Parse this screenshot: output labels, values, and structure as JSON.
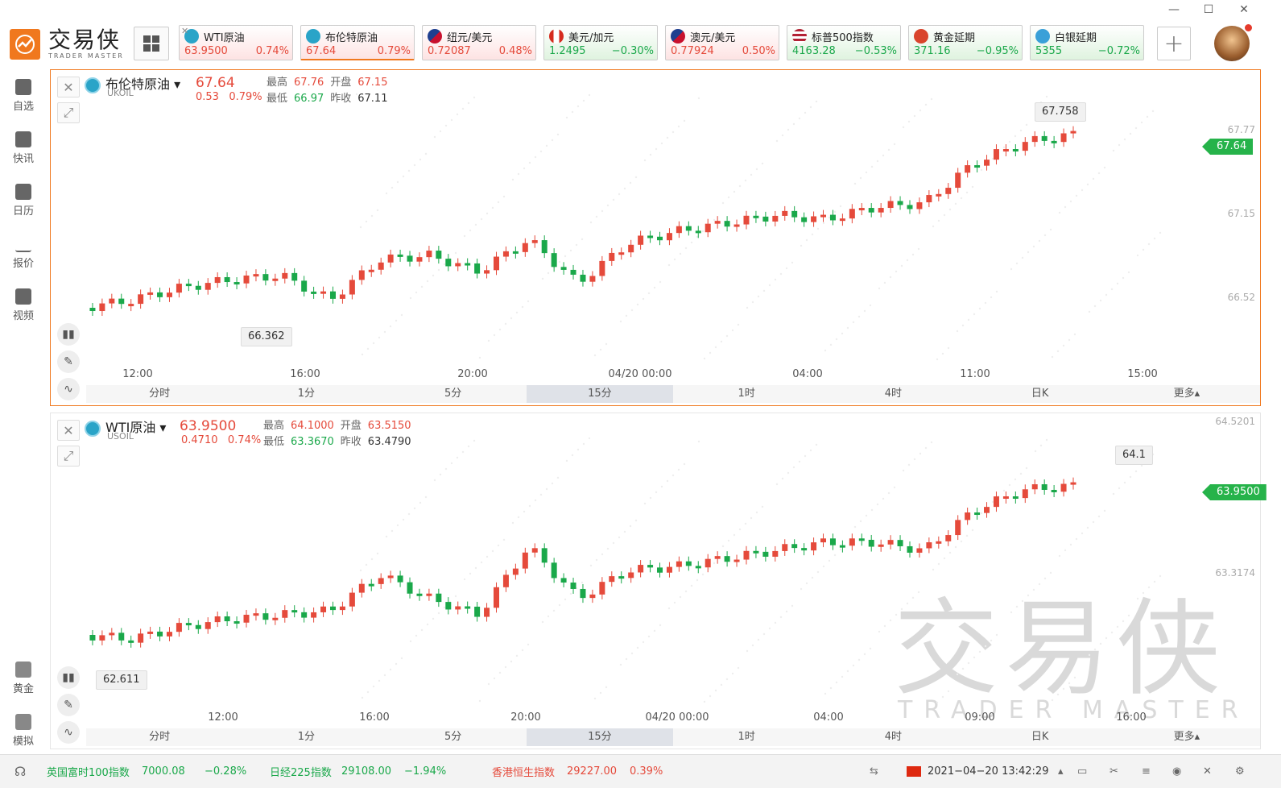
{
  "window": {
    "min": "—",
    "max": "☐",
    "close": "✕"
  },
  "logo": {
    "cn": "交易侠",
    "en": "TRADER MASTER"
  },
  "tickers": [
    {
      "name": "WTI原油",
      "price": "63.9500",
      "change": "0.74%",
      "dir": "up"
    },
    {
      "name": "布伦特原油",
      "price": "67.64",
      "change": "0.79%",
      "dir": "up"
    },
    {
      "name": "纽元/美元",
      "price": "0.72087",
      "change": "0.48%",
      "dir": "up"
    },
    {
      "name": "美元/加元",
      "price": "1.2495",
      "change": "−0.30%",
      "dir": "down"
    },
    {
      "name": "澳元/美元",
      "price": "0.77924",
      "change": "0.50%",
      "dir": "up"
    },
    {
      "name": "标普500指数",
      "price": "4163.28",
      "change": "−0.53%",
      "dir": "down"
    },
    {
      "name": "黄金延期",
      "price": "371.16",
      "change": "−0.95%",
      "dir": "down"
    },
    {
      "name": "白银延期",
      "price": "5355",
      "change": "−0.72%",
      "dir": "down"
    }
  ],
  "sidebar": {
    "items": [
      {
        "label": "自选"
      },
      {
        "label": "快讯"
      },
      {
        "label": "日历"
      },
      {
        "label": "报价"
      },
      {
        "label": "视频"
      },
      {
        "label": "黄金"
      },
      {
        "label": "模拟"
      }
    ]
  },
  "panel1": {
    "name": "布伦特原油",
    "code": "UKOIL",
    "price": "67.64",
    "chg_abs": "0.53",
    "chg_pct": "0.79%",
    "high_label": "最高",
    "high": "67.76",
    "open_label": "开盘",
    "open": "67.15",
    "low_label": "最低",
    "low": "66.97",
    "prev_label": "昨收",
    "prev": "67.11",
    "y_ticks": [
      "67.77",
      "67.15",
      "66.52"
    ],
    "last_tag": "67.64",
    "max_label": "67.758",
    "min_label": "66.362",
    "x_labels": [
      "12:00",
      "16:00",
      "20:00",
      "04/20 00:00",
      "04:00",
      "11:00",
      "15:00"
    ]
  },
  "panel2": {
    "name": "WTI原油",
    "code": "USOIL",
    "price": "63.9500",
    "chg_abs": "0.4710",
    "chg_pct": "0.74%",
    "high_label": "最高",
    "high": "64.1000",
    "open_label": "开盘",
    "open": "63.5150",
    "low_label": "最低",
    "low": "63.3670",
    "prev_label": "昨收",
    "prev": "63.4790",
    "y_ticks": [
      "64.5201",
      "63.3174"
    ],
    "last_tag": "63.9500",
    "max_label": "64.1",
    "min_label": "62.611",
    "x_labels": [
      "12:00",
      "16:00",
      "20:00",
      "04/20 00:00",
      "04:00",
      "09:00",
      "16:00"
    ]
  },
  "timeframes": [
    "分时",
    "1分",
    "5分",
    "15分",
    "1时",
    "4时",
    "日K",
    "更多▴"
  ],
  "selected_tf": "15分",
  "statusbar": {
    "i1_name": "英国富时100指数",
    "i1_val": "7000.08",
    "i1_chg": "−0.28%",
    "i2_name": "日经225指数",
    "i2_val": "29108.00",
    "i2_chg": "−1.94%",
    "i3_name": "香港恒生指数",
    "i3_val": "29227.00",
    "i3_chg": "0.39%",
    "datetime": "2021−04−20 13:42:29"
  },
  "watermark": {
    "cn": "交易侠",
    "en": "TRADER MASTER"
  },
  "colors": {
    "up": "#e54a3b",
    "down": "#1aa84a",
    "accent": "#f0781e"
  }
}
